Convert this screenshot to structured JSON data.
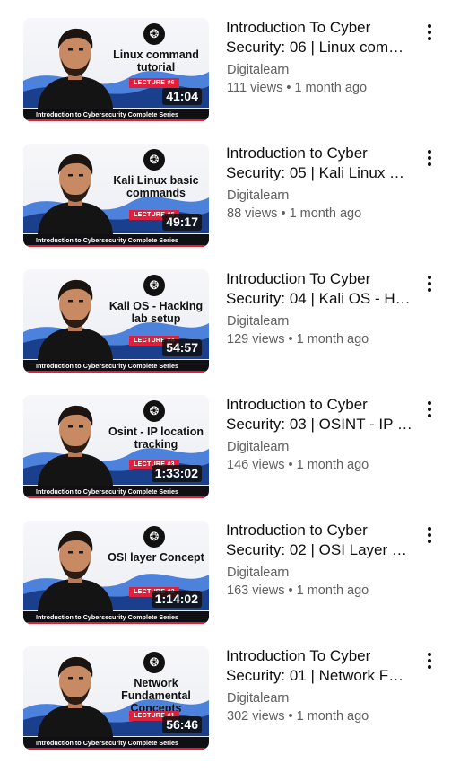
{
  "videos": [
    {
      "title_line1": "Introduction To Cyber",
      "title_line2": "Security: 06 | Linux com…",
      "channel": "Digitalearn",
      "views": "111 views",
      "age": "1 month ago",
      "duration": "41:04",
      "thumb_title": "Linux command tutorial",
      "lecture": "LECTURE #6",
      "series": "Introduction to Cybersecurity Complete Series"
    },
    {
      "title_line1": "Introduction to Cyber",
      "title_line2": "Security: 05 | Kali Linux …",
      "channel": "Digitalearn",
      "views": "88 views",
      "age": "1 month ago",
      "duration": "49:17",
      "thumb_title": "Kali Linux basic commands",
      "lecture": "LECTURE #5",
      "series": "Introduction to Cybersecurity Complete Series"
    },
    {
      "title_line1": "Introduction To Cyber",
      "title_line2": "Security: 04 | Kali OS - H…",
      "channel": "Digitalearn",
      "views": "129 views",
      "age": "1 month ago",
      "duration": "54:57",
      "thumb_title": "Kali OS - Hacking lab setup",
      "lecture": "LECTURE #4",
      "series": "Introduction to Cybersecurity Complete Series"
    },
    {
      "title_line1": "Introduction to Cyber",
      "title_line2": "Security: 03 | OSINT - IP …",
      "channel": "Digitalearn",
      "views": "146 views",
      "age": "1 month ago",
      "duration": "1:33:02",
      "thumb_title": "Osint - IP location tracking",
      "lecture": "LECTURE #3",
      "series": "Introduction to Cybersecurity Complete Series"
    },
    {
      "title_line1": "Introduction to Cyber",
      "title_line2": "Security: 02 | OSI Layer …",
      "channel": "Digitalearn",
      "views": "163 views",
      "age": "1 month ago",
      "duration": "1:14:02",
      "thumb_title": "OSI layer Concept",
      "lecture": "LECTURE #2",
      "series": "Introduction to Cybersecurity Complete Series"
    },
    {
      "title_line1": "Introduction To Cyber",
      "title_line2": "Security: 01 | Network F…",
      "channel": "Digitalearn",
      "views": "302 views",
      "age": "1 month ago",
      "duration": "56:46",
      "thumb_title": "Network Fundamental Concepts",
      "lecture": "LECTURE #1",
      "series": "Introduction to Cybersecurity Complete Series"
    }
  ],
  "meta_separator": " • ",
  "badge_icon": "❂",
  "colors": {
    "accent": "#e0203a",
    "text": "#0f0f0f",
    "secondary": "#606060"
  }
}
